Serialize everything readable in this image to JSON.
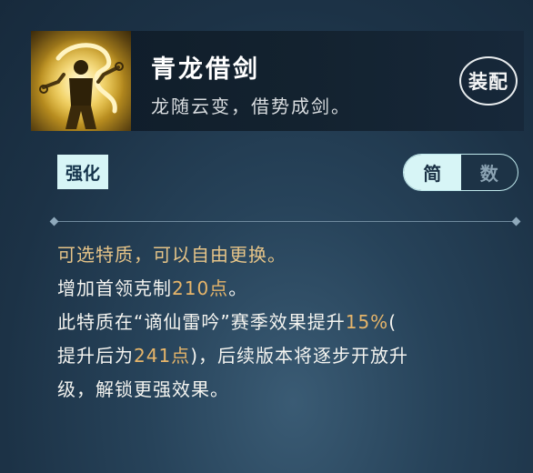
{
  "skill": {
    "name": "青龙借剑",
    "flavor": "龙随云变，借势成剑。",
    "equip_label": "装配"
  },
  "tag": {
    "label": "强化"
  },
  "toggle": {
    "options": [
      "简",
      "数"
    ],
    "active": "简"
  },
  "description": {
    "line1": "可选特质，可以自由更换。",
    "line2_prefix": "增加首领克制",
    "line2_value": "210点",
    "line2_suffix": "。",
    "line3_prefix": "此特质在“谪仙雷吟”赛季效果提升",
    "line3_value": "15%",
    "line3_suffix": "(",
    "line4_prefix": "提升后为",
    "line4_value": "241点",
    "line4_suffix": ")，后续版本将逐步开放升",
    "line5": "级，解锁更强效果。"
  },
  "colors": {
    "accent_text": "#e6c488",
    "value_text": "#e6b56a",
    "tag_bg": "#d7f5f6"
  }
}
